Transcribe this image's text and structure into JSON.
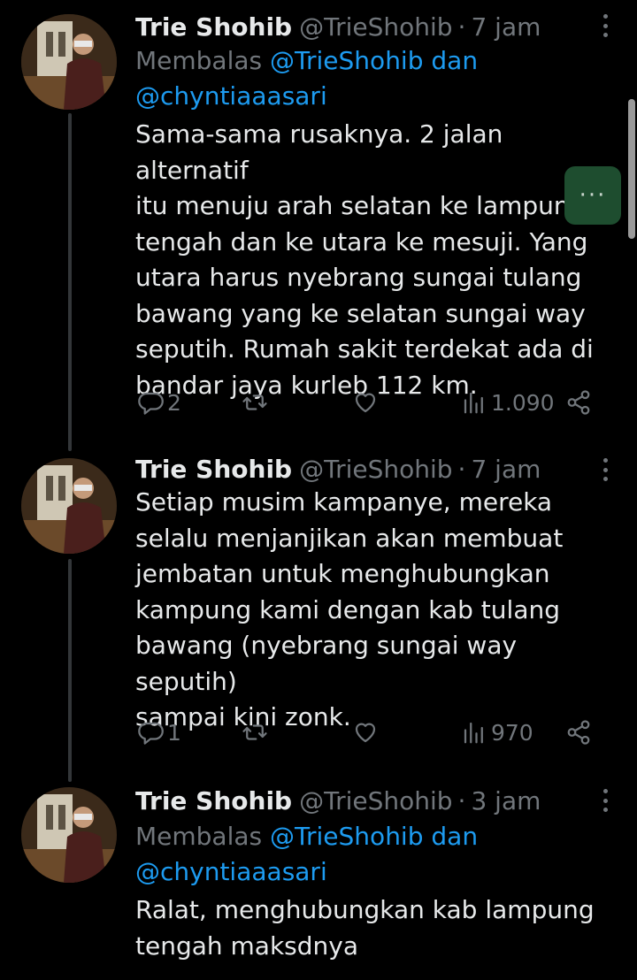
{
  "tweets": [
    {
      "name": "Trie Shohib",
      "handle": "@TrieShohib",
      "separator": "·",
      "time": "7 jam",
      "reply_label": "Membalas",
      "reply_mention_1": "@TrieShohib dan",
      "reply_mention_2": "@chyntiaaasari",
      "text": [
        "Sama-sama rusaknya. 2 jalan alternatif",
        "itu menuju arah selatan ke lampung",
        "tengah dan ke utara ke mesuji. Yang",
        "utara harus nyebrang sungai tulang",
        "bawang yang ke selatan sungai way",
        "seputih. Rumah sakit terdekat ada di",
        "bandar jaya kurleb 112 km."
      ],
      "replies": "2",
      "views": "1.090"
    },
    {
      "name": "Trie Shohib",
      "handle": "@TrieShohib",
      "separator": "·",
      "time": "7 jam",
      "text": [
        "Setiap musim kampanye, mereka",
        "selalu menjanjikan akan membuat",
        "jembatan untuk menghubungkan",
        "kampung kami dengan kab tulang",
        "bawang (nyebrang sungai way seputih)",
        "sampai kini zonk."
      ],
      "replies": "1",
      "views": "970"
    },
    {
      "name": "Trie Shohib",
      "handle": "@TrieShohib",
      "separator": "·",
      "time": "3 jam",
      "reply_label": "Membalas",
      "reply_mention_1": "@TrieShohib dan",
      "reply_mention_2": "@chyntiaaasari",
      "text": [
        "Ralat, menghubungkan kab lampung",
        "tengah maksdnya"
      ]
    }
  ],
  "overlay": {
    "fab_label": "···"
  },
  "colors": {
    "background": "#000000",
    "text": "#e7e9ea",
    "muted": "#71767b",
    "link": "#1d9bf0",
    "fab": "#1e4d2f"
  },
  "icons": [
    "reply-icon",
    "retweet-icon",
    "like-icon",
    "views-icon",
    "share-icon",
    "more-icon"
  ]
}
